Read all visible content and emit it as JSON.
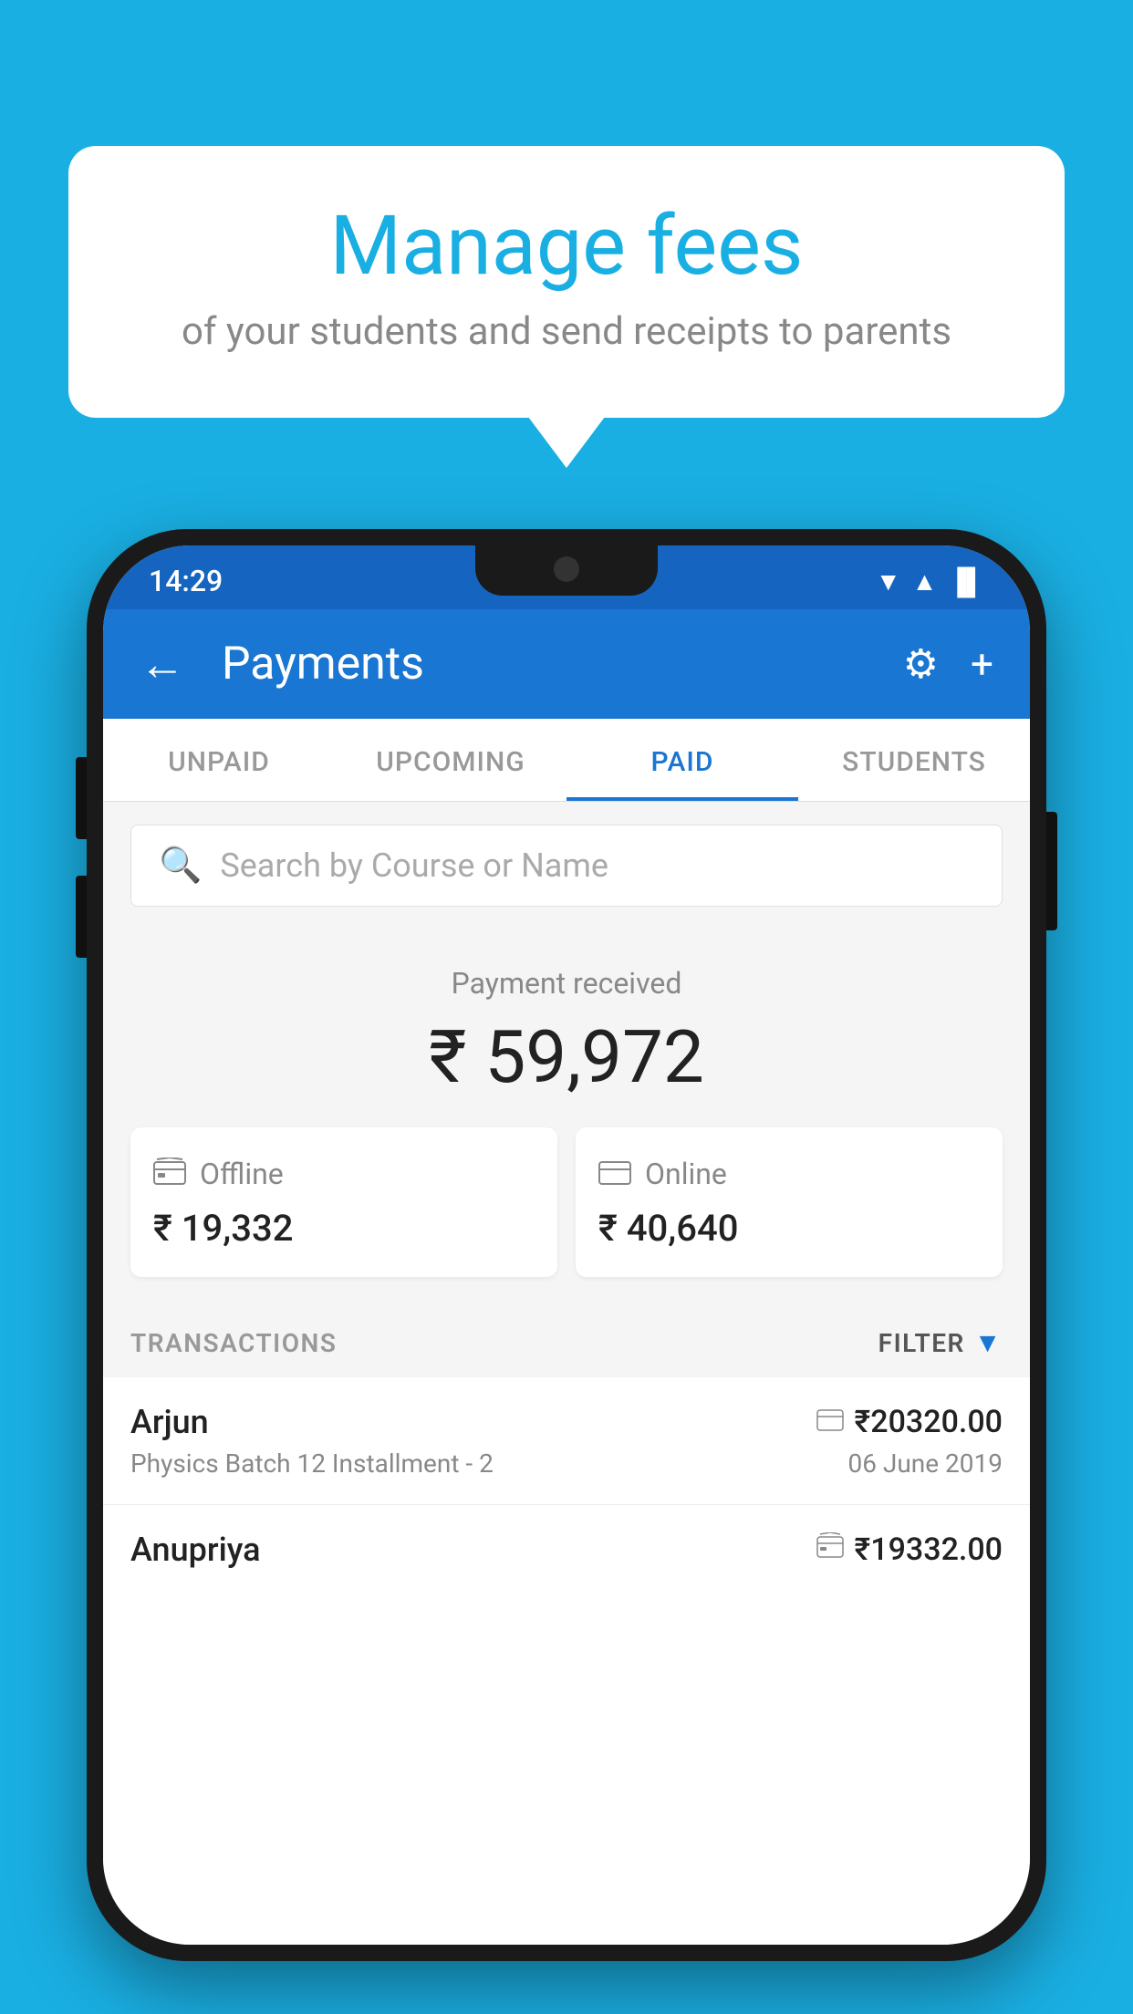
{
  "background_color": "#1AAFE3",
  "bubble": {
    "title": "Manage fees",
    "subtitle": "of your students and send receipts to parents"
  },
  "status_bar": {
    "time": "14:29",
    "wifi": "▼",
    "signal": "▲",
    "battery": "▐"
  },
  "app_bar": {
    "title": "Payments",
    "back_label": "←",
    "gear_label": "⚙",
    "plus_label": "+"
  },
  "tabs": [
    {
      "label": "UNPAID",
      "active": false
    },
    {
      "label": "UPCOMING",
      "active": false
    },
    {
      "label": "PAID",
      "active": true
    },
    {
      "label": "STUDENTS",
      "active": false
    }
  ],
  "search": {
    "placeholder": "Search by Course or Name"
  },
  "payment_summary": {
    "received_label": "Payment received",
    "total_amount": "₹ 59,972",
    "offline": {
      "icon": "💳",
      "label": "Offline",
      "amount": "₹ 19,332"
    },
    "online": {
      "icon": "💳",
      "label": "Online",
      "amount": "₹ 40,640"
    }
  },
  "transactions": {
    "label": "TRANSACTIONS",
    "filter_label": "FILTER",
    "rows": [
      {
        "name": "Arjun",
        "amount": "₹20320.00",
        "amount_icon": "💳",
        "course": "Physics Batch 12 Installment - 2",
        "date": "06 June 2019"
      },
      {
        "name": "Anupriya",
        "amount": "₹19332.00",
        "amount_icon": "💵",
        "course": "",
        "date": ""
      }
    ]
  }
}
